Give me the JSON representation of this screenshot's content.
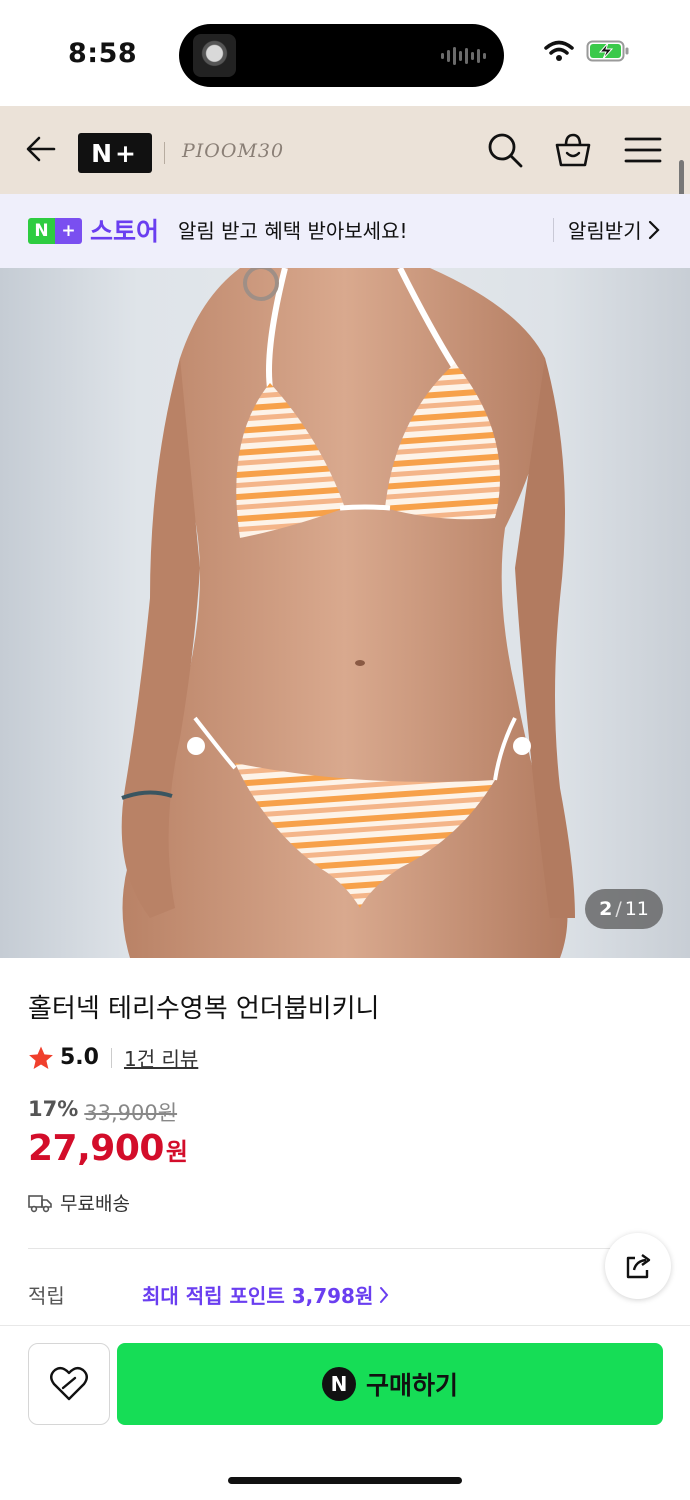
{
  "status_bar": {
    "time": "8:58"
  },
  "header": {
    "logo": "N+",
    "store_name": "PIOOM30"
  },
  "promo": {
    "badge_n": "N",
    "badge_plus": "+",
    "store_label": "스토어",
    "message": "알림 받고 혜택 받아보세요!",
    "action_label": "알림받기"
  },
  "image": {
    "counter_current": "2",
    "counter_total": "11"
  },
  "product": {
    "title": "홀터넥 테리수영복 언더붑비키니",
    "rating": "5.0",
    "review_link": "1건 리뷰",
    "discount_rate": "17%",
    "original_price": "33,900원",
    "sale_price": "27,900",
    "price_unit": "원",
    "shipping": "무료배송"
  },
  "points": {
    "label": "적립",
    "value": "최대 적립 포인트 3,798원"
  },
  "bottom_bar": {
    "buy_icon": "N",
    "buy_label": "구매하기"
  },
  "colors": {
    "header_bg": "#ebe2d8",
    "promo_bg": "#efeffb",
    "accent_purple": "#6a3ef0",
    "naver_green": "#16dd56",
    "price_red": "#d30d2a"
  }
}
